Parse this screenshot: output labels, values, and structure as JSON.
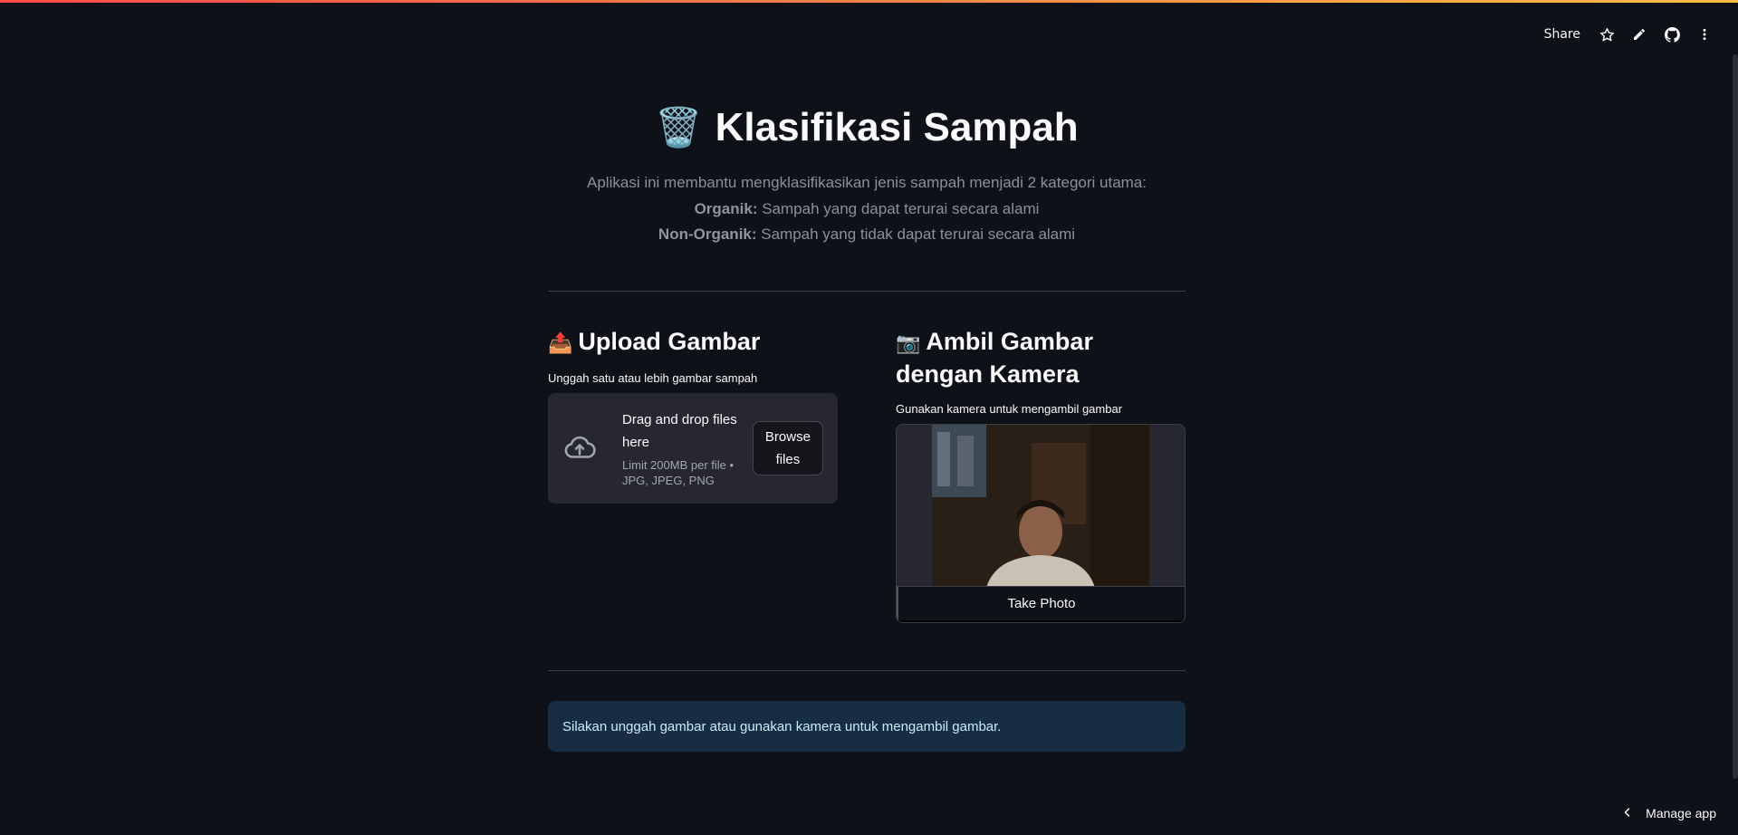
{
  "toolbar": {
    "share_label": "Share",
    "icons": [
      "star-icon",
      "pencil-icon",
      "github-icon",
      "more-vertical-icon"
    ]
  },
  "header": {
    "emoji": "🗑️",
    "title": "Klasifikasi Sampah",
    "description_line1": "Aplikasi ini membantu mengklasifikasikan jenis sampah menjadi 2 kategori utama:",
    "organik_label": "Organik:",
    "organik_text": "Sampah yang dapat terurai secara alami",
    "nonorganik_label": "Non-Organik:",
    "nonorganik_text": "Sampah yang tidak dapat terurai secara alami"
  },
  "upload": {
    "emoji": "📤",
    "title": "Upload Gambar",
    "label": "Unggah satu atau lebih gambar sampah",
    "drop_text": "Drag and drop files here",
    "limit_text": "Limit 200MB per file • JPG, JPEG, PNG",
    "browse_label": "Browse files"
  },
  "camera": {
    "emoji": "📷",
    "title": "Ambil Gambar dengan Kamera",
    "label": "Gunakan kamera untuk mengambil gambar",
    "take_photo_label": "Take Photo"
  },
  "info": {
    "message": "Silakan unggah gambar atau gunakan kamera untuk mengambil gambar."
  },
  "footer": {
    "manage_app_label": "Manage app"
  },
  "colors": {
    "background": "#0e1117",
    "card": "#262730",
    "info_bg": "#172d43",
    "info_text": "#c7ebff"
  }
}
